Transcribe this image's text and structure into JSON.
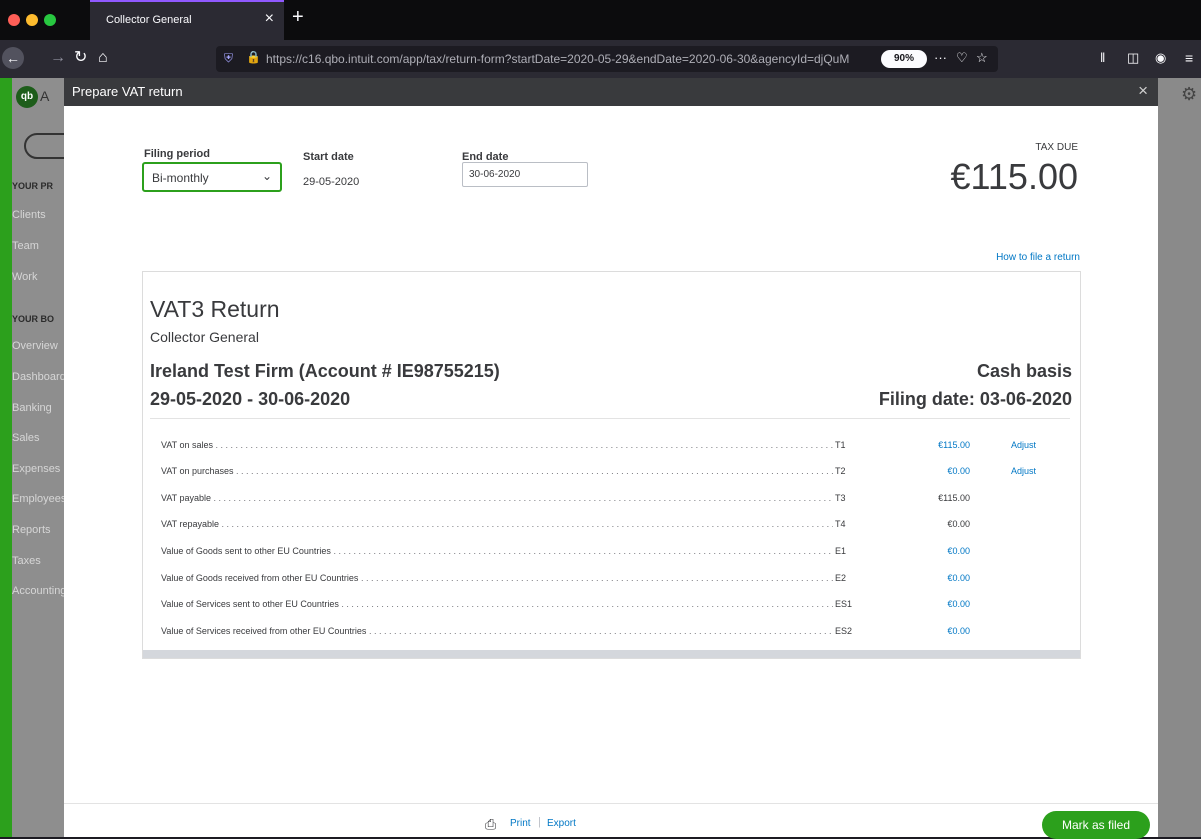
{
  "browser": {
    "tab_title": "Collector General",
    "tab_close": "×",
    "new_tab": "+",
    "url": "https://c16.qbo.intuit.com/app/tax/return-form?startDate=2020-05-29&endDate=2020-06-30&agencyId=djQuM",
    "zoom": "90%",
    "more": "···"
  },
  "app_nav": {
    "logo": "qb",
    "logo_letter": "A",
    "items": [
      {
        "label": "YOUR PR",
        "header": true
      },
      {
        "label": "Clients"
      },
      {
        "label": "Team"
      },
      {
        "label": "Work"
      },
      {
        "label": "YOUR BO",
        "header": true
      },
      {
        "label": "Overview"
      },
      {
        "label": "Dashboard"
      },
      {
        "label": "Banking"
      },
      {
        "label": "Sales"
      },
      {
        "label": "Expenses"
      },
      {
        "label": "Employees"
      },
      {
        "label": "Reports"
      },
      {
        "label": "Taxes"
      },
      {
        "label": "Accounting"
      }
    ]
  },
  "modal": {
    "title": "Prepare VAT return",
    "close": "×",
    "filing_period_label": "Filing period",
    "filing_period_value": "Bi-monthly",
    "start_date_label": "Start date",
    "start_date_value": "29-05-2020",
    "end_date_label": "End date",
    "end_date_value": "30-06-2020",
    "tax_due_label": "TAX DUE",
    "tax_due_value": "€115.00",
    "how_to_link": "How to file a return"
  },
  "report": {
    "title": "VAT3 Return",
    "subtitle": "Collector General",
    "firm": "Ireland Test Firm (Account # IE98755215)",
    "period": "29-05-2020 - 30-06-2020",
    "basis": "Cash basis",
    "filing_date": "Filing date: 03-06-2020",
    "rows": [
      {
        "label": "VAT on sales",
        "code": "T1",
        "value": "€115.00",
        "link": true,
        "adjust": "Adjust"
      },
      {
        "label": "VAT on purchases",
        "code": "T2",
        "value": "€0.00",
        "link": true,
        "adjust": "Adjust"
      },
      {
        "label": "VAT payable",
        "code": "T3",
        "value": "€115.00",
        "link": false,
        "adjust": ""
      },
      {
        "label": "VAT repayable",
        "code": "T4",
        "value": "€0.00",
        "link": false,
        "adjust": ""
      },
      {
        "label": "Value of Goods sent to other EU Countries",
        "code": "E1",
        "value": "€0.00",
        "link": true,
        "adjust": ""
      },
      {
        "label": "Value of Goods received from other EU Countries",
        "code": "E2",
        "value": "€0.00",
        "link": true,
        "adjust": ""
      },
      {
        "label": "Value of Services sent to other EU Countries",
        "code": "ES1",
        "value": "€0.00",
        "link": true,
        "adjust": ""
      },
      {
        "label": "Value of Services received from other EU Countries",
        "code": "ES2",
        "value": "€0.00",
        "link": true,
        "adjust": ""
      }
    ]
  },
  "footer": {
    "print": "Print",
    "separator": "|",
    "export": "Export",
    "mark_filed": "Mark as filed"
  },
  "colors": {
    "brand_green": "#2ca01c",
    "link_blue": "#0077c5",
    "modal_header": "#393a3d"
  }
}
